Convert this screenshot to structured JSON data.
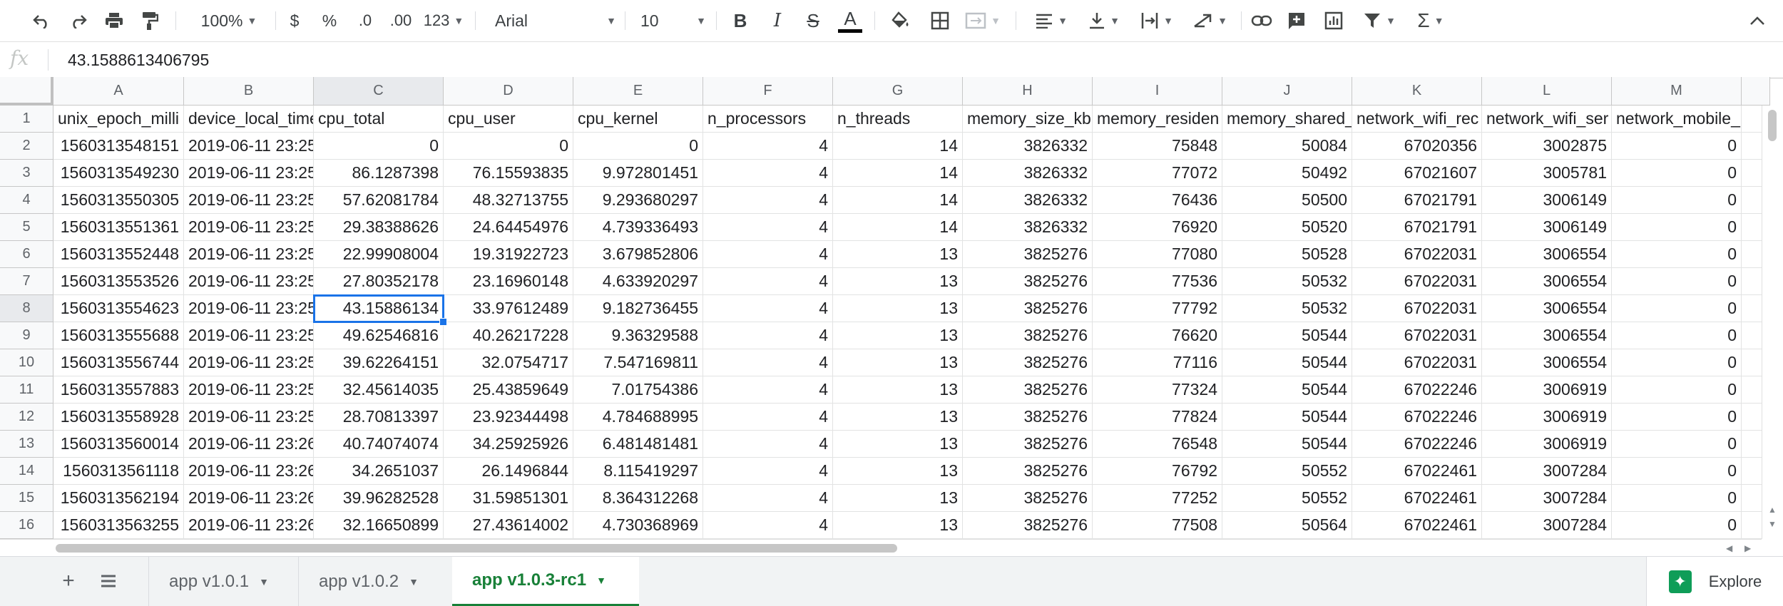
{
  "toolbar": {
    "zoom": "100%",
    "currency": "$",
    "percent": "%",
    "decrease_decimal": ".0",
    "increase_decimal": ".00",
    "number_format": "123",
    "font": "Arial",
    "font_size": "10",
    "bold": "B",
    "italic": "I",
    "strikethrough": "S",
    "text_color": "A",
    "sigma": "Σ"
  },
  "formula_bar": {
    "fx": "fx",
    "value": "43.1588613406795"
  },
  "columns": [
    "A",
    "B",
    "C",
    "D",
    "E",
    "F",
    "G",
    "H",
    "I",
    "J",
    "K",
    "L",
    "M"
  ],
  "row_numbers": [
    "1",
    "2",
    "3",
    "4",
    "5",
    "6",
    "7",
    "8",
    "9",
    "10",
    "11",
    "12",
    "13",
    "14",
    "15",
    "16"
  ],
  "headers": [
    "unix_epoch_milli",
    "device_local_time",
    "cpu_total",
    "cpu_user",
    "cpu_kernel",
    "n_processors",
    "n_threads",
    "memory_size_kb",
    "memory_residen",
    "memory_shared_",
    "network_wifi_rec",
    "network_wifi_ser",
    "network_mobile_"
  ],
  "rows": [
    [
      "1560313548151",
      "2019-06-11 23:25",
      "0",
      "0",
      "0",
      "4",
      "14",
      "3826332",
      "75848",
      "50084",
      "67020356",
      "3002875",
      "0"
    ],
    [
      "1560313549230",
      "2019-06-11 23:25",
      "86.1287398",
      "76.15593835",
      "9.972801451",
      "4",
      "14",
      "3826332",
      "77072",
      "50492",
      "67021607",
      "3005781",
      "0"
    ],
    [
      "1560313550305",
      "2019-06-11 23:25",
      "57.62081784",
      "48.32713755",
      "9.293680297",
      "4",
      "14",
      "3826332",
      "76436",
      "50500",
      "67021791",
      "3006149",
      "0"
    ],
    [
      "1560313551361",
      "2019-06-11 23:25",
      "29.38388626",
      "24.64454976",
      "4.739336493",
      "4",
      "14",
      "3826332",
      "76920",
      "50520",
      "67021791",
      "3006149",
      "0"
    ],
    [
      "1560313552448",
      "2019-06-11 23:25",
      "22.99908004",
      "19.31922723",
      "3.679852806",
      "4",
      "13",
      "3825276",
      "77080",
      "50528",
      "67022031",
      "3006554",
      "0"
    ],
    [
      "1560313553526",
      "2019-06-11 23:25",
      "27.80352178",
      "23.16960148",
      "4.633920297",
      "4",
      "13",
      "3825276",
      "77536",
      "50532",
      "67022031",
      "3006554",
      "0"
    ],
    [
      "1560313554623",
      "2019-06-11 23:25",
      "43.15886134",
      "33.97612489",
      "9.182736455",
      "4",
      "13",
      "3825276",
      "77792",
      "50532",
      "67022031",
      "3006554",
      "0"
    ],
    [
      "1560313555688",
      "2019-06-11 23:25",
      "49.62546816",
      "40.26217228",
      "9.36329588",
      "4",
      "13",
      "3825276",
      "76620",
      "50544",
      "67022031",
      "3006554",
      "0"
    ],
    [
      "1560313556744",
      "2019-06-11 23:25",
      "39.62264151",
      "32.0754717",
      "7.547169811",
      "4",
      "13",
      "3825276",
      "77116",
      "50544",
      "67022031",
      "3006554",
      "0"
    ],
    [
      "1560313557883",
      "2019-06-11 23:25",
      "32.45614035",
      "25.43859649",
      "7.01754386",
      "4",
      "13",
      "3825276",
      "77324",
      "50544",
      "67022246",
      "3006919",
      "0"
    ],
    [
      "1560313558928",
      "2019-06-11 23:25",
      "28.70813397",
      "23.92344498",
      "4.784688995",
      "4",
      "13",
      "3825276",
      "77824",
      "50544",
      "67022246",
      "3006919",
      "0"
    ],
    [
      "1560313560014",
      "2019-06-11 23:26",
      "40.74074074",
      "34.25925926",
      "6.481481481",
      "4",
      "13",
      "3825276",
      "76548",
      "50544",
      "67022246",
      "3006919",
      "0"
    ],
    [
      "1560313561118",
      "2019-06-11 23:26",
      "34.2651037",
      "26.1496844",
      "8.115419297",
      "4",
      "13",
      "3825276",
      "76792",
      "50552",
      "67022461",
      "3007284",
      "0"
    ],
    [
      "1560313562194",
      "2019-06-11 23:26",
      "39.96282528",
      "31.59851301",
      "8.364312268",
      "4",
      "13",
      "3825276",
      "77252",
      "50552",
      "67022461",
      "3007284",
      "0"
    ],
    [
      "1560313563255",
      "2019-06-11 23:26",
      "32.16650899",
      "27.43614002",
      "4.730368969",
      "4",
      "13",
      "3825276",
      "77508",
      "50564",
      "67022461",
      "3007284",
      "0"
    ]
  ],
  "sheet_tabs": [
    "app v1.0.1",
    "app v1.0.2",
    "app v1.0.3-rc1"
  ],
  "active_sheet": "app v1.0.3-rc1",
  "explore_label": "Explore",
  "colors": {
    "active_cell_border": "#1a73e8",
    "active_tab": "#188038",
    "explore_icon": "#0f9d58"
  },
  "icons": [
    "undo-icon",
    "redo-icon",
    "print-icon",
    "paint-format-icon",
    "fill-color-icon",
    "borders-icon",
    "merge-icon",
    "align-icon",
    "valign-icon",
    "wrap-icon",
    "rotate-icon",
    "link-icon",
    "comment-icon",
    "chart-icon",
    "filter-icon",
    "functions-icon",
    "collapse-icon",
    "add-sheet-icon",
    "all-sheets-icon",
    "explore-icon"
  ]
}
